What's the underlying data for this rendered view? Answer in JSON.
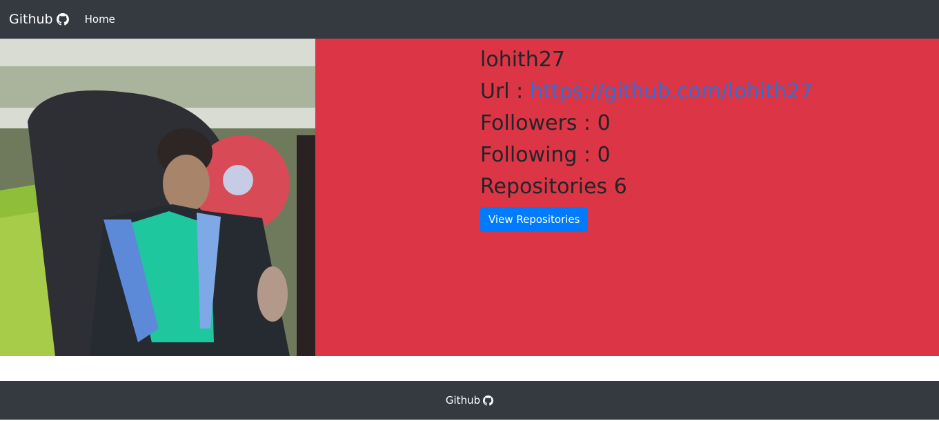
{
  "navbar": {
    "brand_label": "Github",
    "brand_icon": "github-icon",
    "home_label": "Home"
  },
  "profile": {
    "username": "lohith27",
    "url_label": "Url :",
    "url": "https://github.com/lohith27",
    "followers_label": "Followers : 0",
    "following_label": "Following : 0",
    "repositories_label": "Repositories 6",
    "view_repos_button": "View Repositories",
    "avatar_alt": "lohith27 avatar"
  },
  "footer": {
    "label": "Github",
    "icon": "github-icon"
  },
  "colors": {
    "navbar_bg": "#343a40",
    "profile_bg": "#dc3545",
    "button_bg": "#007bff",
    "link": "#2f6fd6"
  }
}
